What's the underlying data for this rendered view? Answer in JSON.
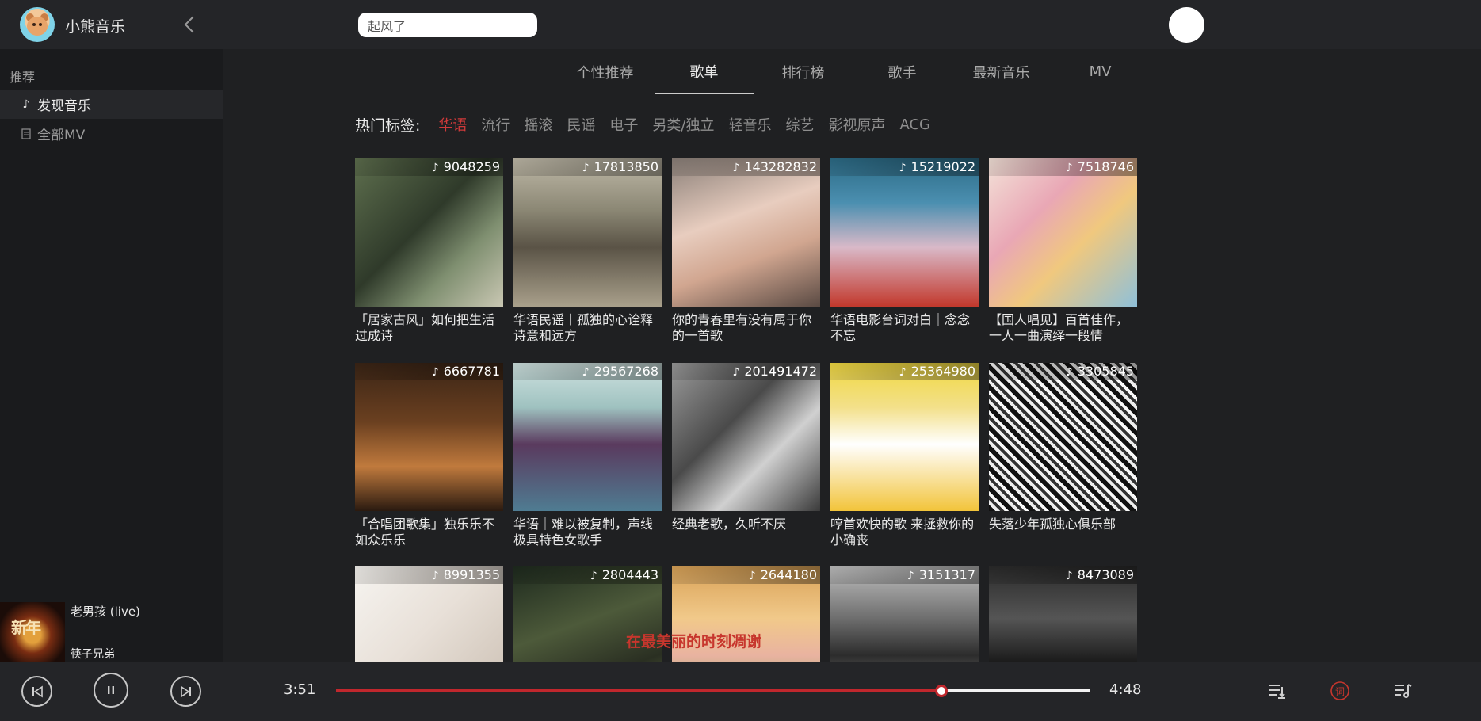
{
  "app": {
    "title": "小熊音乐"
  },
  "search": {
    "value": "起风了"
  },
  "sidebar": {
    "section": "推荐",
    "items": [
      {
        "label": "发现音乐",
        "icon": "music-note-icon",
        "active": true
      },
      {
        "label": "全部MV",
        "icon": "document-icon",
        "active": false
      }
    ]
  },
  "now_playing": {
    "cover_text": "新年",
    "title": "老男孩 (live)",
    "artist": "筷子兄弟"
  },
  "tabs": [
    {
      "label": "个性推荐"
    },
    {
      "label": "歌单",
      "active": true
    },
    {
      "label": "排行榜"
    },
    {
      "label": "歌手"
    },
    {
      "label": "最新音乐"
    },
    {
      "label": "MV"
    }
  ],
  "hot_tags": {
    "label": "热门标签:",
    "items": [
      "华语",
      "流行",
      "摇滚",
      "民谣",
      "电子",
      "另类/独立",
      "轻音乐",
      "综艺",
      "影视原声",
      "ACG"
    ],
    "active_index": 0
  },
  "playlists": [
    {
      "count": "9048259",
      "title": "「居家古风」如何把生活过成诗"
    },
    {
      "count": "17813850",
      "title": "华语民谣丨孤独的心诠释诗意和远方"
    },
    {
      "count": "143282832",
      "title": "你的青春里有没有属于你的一首歌"
    },
    {
      "count": "15219022",
      "title": "华语电影台词对白｜念念不忘"
    },
    {
      "count": "7518746",
      "title": "【国人唱见】百首佳作，一人一曲演绎一段情"
    },
    {
      "count": "6667781",
      "title": "「合唱团歌集」独乐乐不如众乐乐"
    },
    {
      "count": "29567268",
      "title": "华语｜难以被复制，声线极具特色女歌手"
    },
    {
      "count": "201491472",
      "title": "经典老歌，久听不厌"
    },
    {
      "count": "25364980",
      "title": "哼首欢快的歌 来拯救你的小确丧"
    },
    {
      "count": "3305845",
      "title": "失落少年孤独心俱乐部"
    },
    {
      "count": "8991355",
      "title": ""
    },
    {
      "count": "2804443",
      "title": ""
    },
    {
      "count": "2644180",
      "title": ""
    },
    {
      "count": "3151317",
      "title": ""
    },
    {
      "count": "8473089",
      "title": ""
    }
  ],
  "lyric": "在最美丽的时刻凋谢",
  "player": {
    "current_time": "3:51",
    "total_time": "4:48",
    "progress": 0.803
  },
  "colors": {
    "accent": "#c1272d",
    "bg": "#1f2022",
    "sidebar": "#1a1b1d",
    "bar": "#242528"
  }
}
